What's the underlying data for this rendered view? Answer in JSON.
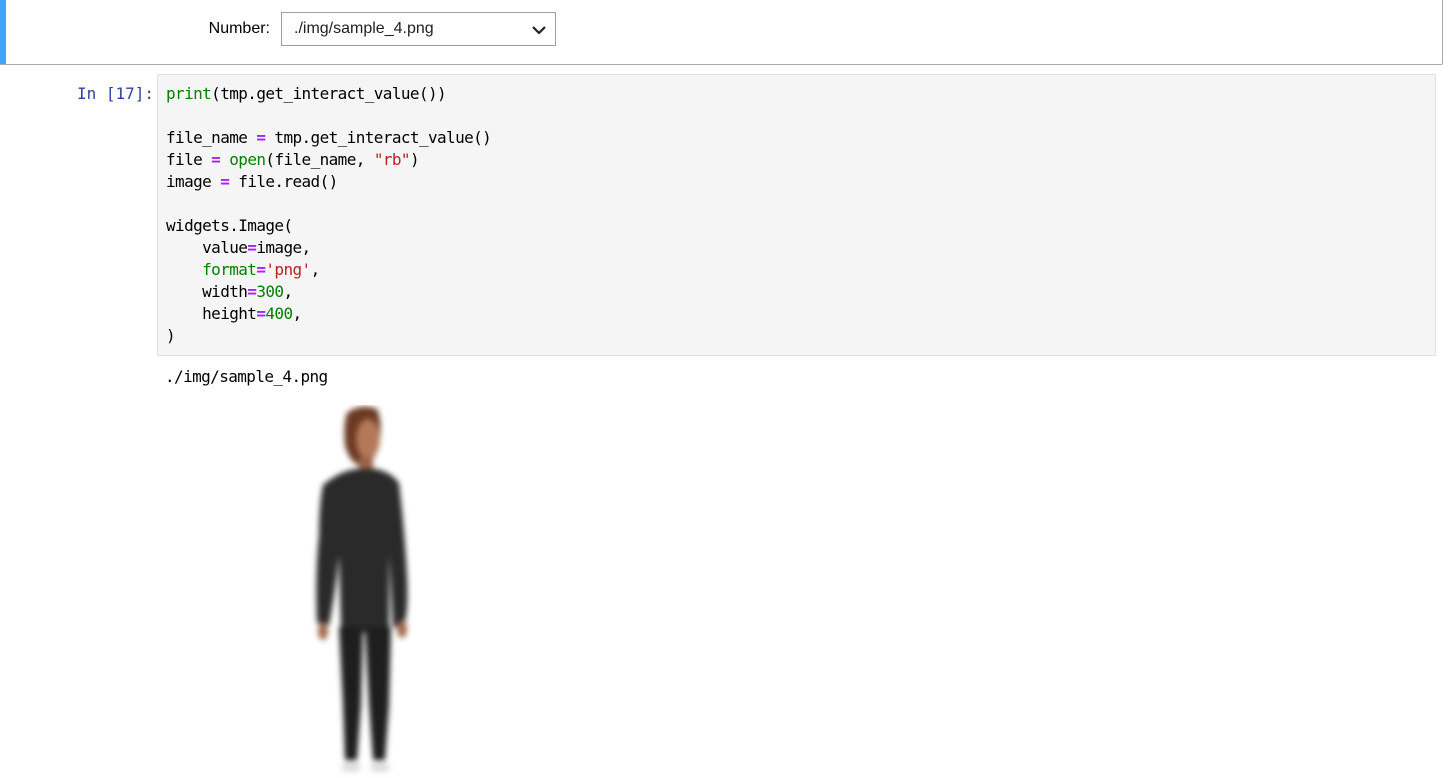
{
  "widget": {
    "label": "Number:",
    "dropdown_value": "./img/sample_4.png"
  },
  "cell": {
    "prompt": "In [17]:",
    "code_lines": [
      [
        {
          "t": "print",
          "c": "builtin"
        },
        {
          "t": "(tmp.get_interact_value())",
          "c": ""
        }
      ],
      [],
      [
        {
          "t": "file_name ",
          "c": ""
        },
        {
          "t": "=",
          "c": "op"
        },
        {
          "t": " tmp.get_interact_value()",
          "c": ""
        }
      ],
      [
        {
          "t": "file ",
          "c": ""
        },
        {
          "t": "=",
          "c": "op"
        },
        {
          "t": " ",
          "c": ""
        },
        {
          "t": "open",
          "c": "builtin"
        },
        {
          "t": "(file_name, ",
          "c": ""
        },
        {
          "t": "\"rb\"",
          "c": "str"
        },
        {
          "t": ")",
          "c": ""
        }
      ],
      [
        {
          "t": "image ",
          "c": ""
        },
        {
          "t": "=",
          "c": "op"
        },
        {
          "t": " file.read()",
          "c": ""
        }
      ],
      [],
      [
        {
          "t": "widgets.Image(",
          "c": ""
        }
      ],
      [
        {
          "t": "    value",
          "c": ""
        },
        {
          "t": "=",
          "c": "op"
        },
        {
          "t": "image,",
          "c": ""
        }
      ],
      [
        {
          "t": "    ",
          "c": ""
        },
        {
          "t": "format",
          "c": "builtin"
        },
        {
          "t": "=",
          "c": "op"
        },
        {
          "t": "'png'",
          "c": "str"
        },
        {
          "t": ",",
          "c": ""
        }
      ],
      [
        {
          "t": "    width",
          "c": ""
        },
        {
          "t": "=",
          "c": "op"
        },
        {
          "t": "300",
          "c": "num"
        },
        {
          "t": ",",
          "c": ""
        }
      ],
      [
        {
          "t": "    height",
          "c": ""
        },
        {
          "t": "=",
          "c": "op"
        },
        {
          "t": "400",
          "c": "num"
        },
        {
          "t": ",",
          "c": ""
        }
      ],
      [
        {
          "t": ")",
          "c": ""
        }
      ]
    ]
  },
  "output": {
    "printed_text": "./img/sample_4.png",
    "image_description_icon": "person-photo"
  },
  "colors": {
    "selected_bar": "#42a5f5",
    "prompt": "#303f9f",
    "builtin": "#008000",
    "operator": "#aa22ff",
    "string": "#ba2121"
  }
}
